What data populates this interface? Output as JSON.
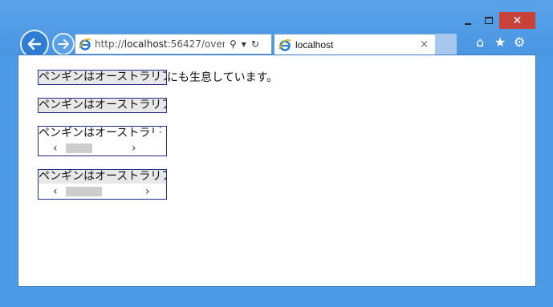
{
  "window": {
    "minimize_icon": "minimize-icon",
    "maximize_icon": "maximize-icon",
    "close_icon": "close-icon",
    "close_glyph": "✕",
    "accent": "#c8423a",
    "frame_color": "#4d9ae6"
  },
  "nav": {
    "back_icon": "back-arrow-icon",
    "forward_icon": "forward-arrow-icon"
  },
  "address": {
    "url_prefix": "http://",
    "url_host": "localhost",
    "url_rest": ":56427/over",
    "search_glyph": "⚲",
    "dropdown_glyph": "▾",
    "refresh_glyph": "↻"
  },
  "tab": {
    "title": "localhost",
    "close_glyph": "×"
  },
  "toolbar": {
    "home_glyph": "⌂",
    "favorites_glyph": "★",
    "settings_glyph": "⚙"
  },
  "content": {
    "inline_field_text": "ペンギンはオーストラリアにも生息しています。",
    "inline_field_visible": "ペンギンはオーストラリア",
    "inline_trailing": "にも生息しています。",
    "field2_text": "ペンギンはオーストラリア",
    "textarea1_text": "ペンギンはオーストラリア",
    "textarea2_text": "ペンギンはオーストラリア",
    "scroll_left_glyph": "‹",
    "scroll_right_glyph": "›",
    "spin_glyph_up": "˄",
    "spin_glyph_down": "˅"
  }
}
